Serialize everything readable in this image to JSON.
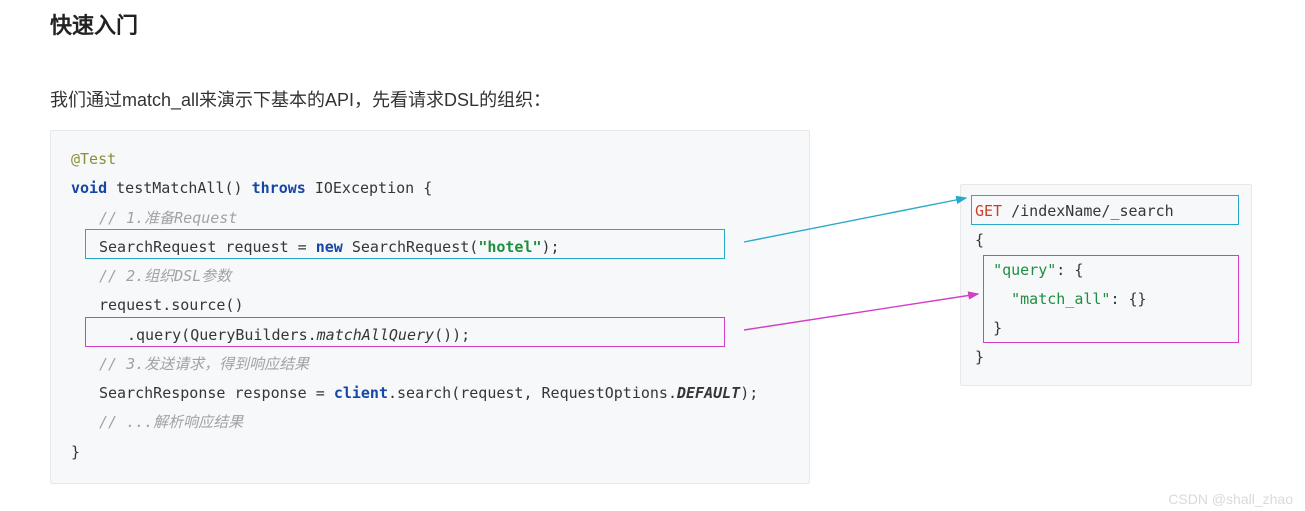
{
  "heading": "快速入门",
  "intro": "我们通过match_all来演示下基本的API，先看请求DSL的组织：",
  "code": {
    "annotation": "@Test",
    "kw_void": "void",
    "fn_name": " testMatchAll() ",
    "kw_throws": "throws",
    "exc": " IOException {",
    "c1": "// 1.准备Request",
    "l2a": "SearchRequest request = ",
    "kw_new": "new",
    "l2b": " SearchRequest(",
    "str_hotel": "\"hotel\"",
    "l2c": ");",
    "c2": "// 2.组织DSL参数",
    "l3": "request.source()",
    "l4a": ".query(QueryBuilders.",
    "l4m": "matchAllQuery",
    "l4b": "());",
    "c3": "// 3.发送请求，得到响应结果",
    "l5a": "SearchResponse response = ",
    "client": "client",
    "l5b": ".search(request, RequestOptions.",
    "const_def": "DEFAULT",
    "l5c": ");",
    "c4": "// ...解析响应结果",
    "close": "}"
  },
  "dsl": {
    "get": "GET",
    "path": " /indexName/_search",
    "open": "{",
    "q_key": "\"query\"",
    "q_open": ": {",
    "ma_key": "\"match_all\"",
    "ma_val": ": {}",
    "q_close": "}",
    "close": "}"
  },
  "watermark": "CSDN @shall_zhao"
}
